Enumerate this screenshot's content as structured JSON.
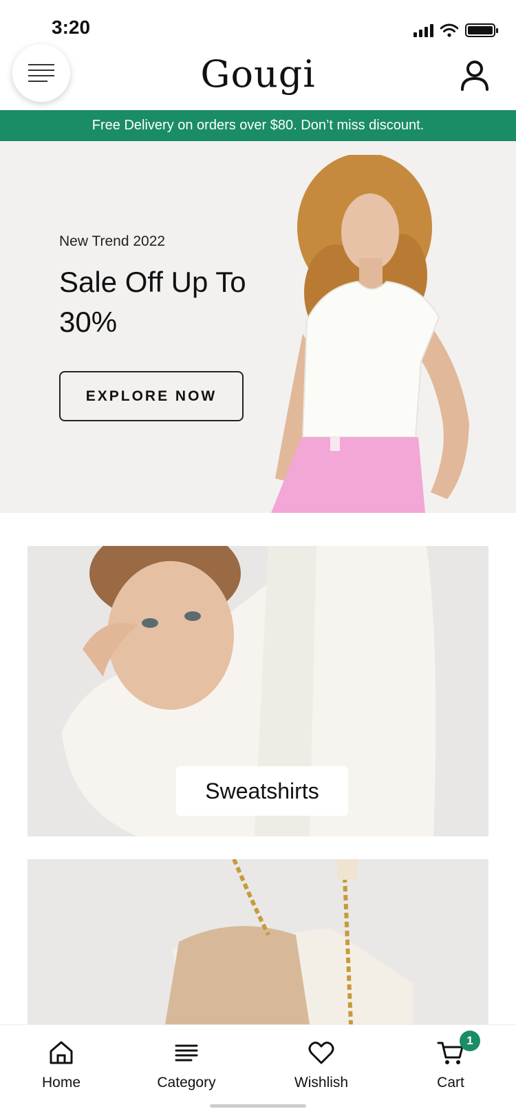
{
  "status_bar": {
    "time": "3:20"
  },
  "header": {
    "brand": "Gougi"
  },
  "promo": {
    "text": "Free Delivery on orders over $80. Don’t miss discount."
  },
  "hero": {
    "kicker": "New Trend 2022",
    "title": "Sale Off Up To 30%",
    "cta_label": "EXPLORE NOW"
  },
  "categories": [
    {
      "label": "Sweatshirts"
    }
  ],
  "bottom_nav": {
    "items": [
      {
        "label": "Home",
        "icon": "home-icon"
      },
      {
        "label": "Category",
        "icon": "list-icon"
      },
      {
        "label": "Wishlish",
        "icon": "heart-icon"
      },
      {
        "label": "Cart",
        "icon": "cart-icon"
      }
    ],
    "cart_count": "1"
  },
  "colors": {
    "accent": "#1a8c66",
    "hero_bg": "#f2f1ef"
  }
}
